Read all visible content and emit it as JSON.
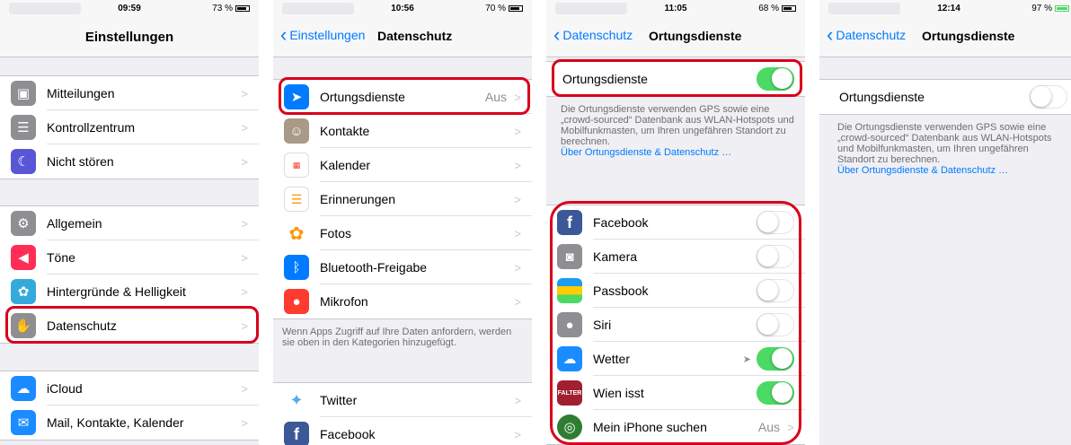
{
  "colors": {
    "ios_blue": "#007aff",
    "switch_green": "#4cd964",
    "highlight_red": "#d8001a"
  },
  "screen1": {
    "status": {
      "time": "09:59",
      "battery": "73 %",
      "battery_level": 0.73
    },
    "nav_title": "Einstellungen",
    "group1": [
      {
        "label": "Mitteilungen",
        "icon": "notifications-icon",
        "color": "#8e8e93"
      },
      {
        "label": "Kontrollzentrum",
        "icon": "control-center-icon",
        "color": "#8e8e93"
      },
      {
        "label": "Nicht stören",
        "icon": "moon-icon",
        "color": "#5856d6"
      }
    ],
    "group2": [
      {
        "label": "Allgemein",
        "icon": "gear-icon",
        "color": "#8e8e93"
      },
      {
        "label": "Töne",
        "icon": "speaker-icon",
        "color": "#ff2d55"
      },
      {
        "label": "Hintergründe & Helligkeit",
        "icon": "flower-icon",
        "color": "#34aadc"
      },
      {
        "label": "Datenschutz",
        "icon": "hand-icon",
        "color": "#8e8e93"
      }
    ],
    "group3": [
      {
        "label": "iCloud",
        "icon": "cloud-icon",
        "color": "#1a8cff"
      },
      {
        "label": "Mail, Kontakte, Kalender",
        "icon": "mail-icon",
        "color": "#1a8cff"
      }
    ]
  },
  "screen2": {
    "status": {
      "time": "10:56",
      "battery": "70 %",
      "battery_level": 0.7
    },
    "back": "Einstellungen",
    "nav_title": "Datenschutz",
    "group1": [
      {
        "label": "Ortungsdienste",
        "value": "Aus",
        "icon": "location-arrow-icon",
        "color": "#007aff"
      },
      {
        "label": "Kontakte",
        "icon": "contacts-icon",
        "color": "#a89a86"
      },
      {
        "label": "Kalender",
        "icon": "calendar-icon",
        "color": "#ffffff"
      },
      {
        "label": "Erinnerungen",
        "icon": "reminders-icon",
        "color": "#ffffff"
      },
      {
        "label": "Fotos",
        "icon": "photos-icon",
        "color": "#ffffff"
      },
      {
        "label": "Bluetooth-Freigabe",
        "icon": "bluetooth-icon",
        "color": "#007aff"
      },
      {
        "label": "Mikrofon",
        "icon": "microphone-icon",
        "color": "#ff3b30"
      }
    ],
    "footer": "Wenn Apps Zugriff auf Ihre Daten anfordern, werden sie oben in den Kategorien hinzugefügt.",
    "group2": [
      {
        "label": "Twitter",
        "icon": "twitter-icon",
        "color": "#ffffff"
      },
      {
        "label": "Facebook",
        "icon": "facebook-icon",
        "color": "#3b5998"
      }
    ]
  },
  "screen3": {
    "status": {
      "time": "11:05",
      "battery": "68 %",
      "battery_level": 0.68
    },
    "back": "Datenschutz",
    "nav_title": "Ortungsdienste",
    "main_toggle_label": "Ortungsdienste",
    "main_toggle_on": true,
    "info_text": "Die Ortungsdienste verwenden GPS sowie eine „crowd-sourced“ Datenbank aus WLAN-Hotspots und Mobilfunkmasten, um Ihren ungefähren Standort zu berechnen.",
    "info_link": "Über Ortungsdienste & Datenschutz …",
    "apps": [
      {
        "label": "Facebook",
        "on": false,
        "icon": "facebook-icon",
        "color": "#3b5998"
      },
      {
        "label": "Kamera",
        "on": false,
        "icon": "camera-icon",
        "color": "#8e8e93"
      },
      {
        "label": "Passbook",
        "on": false,
        "icon": "passbook-icon",
        "color": "#1d9bf0"
      },
      {
        "label": "Siri",
        "on": false,
        "icon": "siri-icon",
        "color": "#8e8e93"
      },
      {
        "label": "Wetter",
        "on": true,
        "icon": "weather-icon",
        "color": "#1a8cff"
      },
      {
        "label": "Wien isst",
        "on": true,
        "icon": "wien-isst-icon",
        "color": "#a02030"
      },
      {
        "label": "Mein iPhone suchen",
        "value": "Aus",
        "icon": "radar-icon",
        "color": "#2e7d32"
      }
    ]
  },
  "screen4": {
    "status": {
      "time": "12:14",
      "battery": "97 %",
      "battery_level": 0.97
    },
    "back": "Datenschutz",
    "nav_title": "Ortungsdienste",
    "main_toggle_label": "Ortungsdienste",
    "main_toggle_on": false,
    "info_text": "Die Ortungsdienste verwenden GPS sowie eine „crowd-sourced“ Datenbank aus WLAN-Hotspots und Mobilfunkmasten, um Ihren ungefähren Standort zu berechnen.",
    "info_link": "Über Ortungsdienste & Datenschutz …"
  }
}
